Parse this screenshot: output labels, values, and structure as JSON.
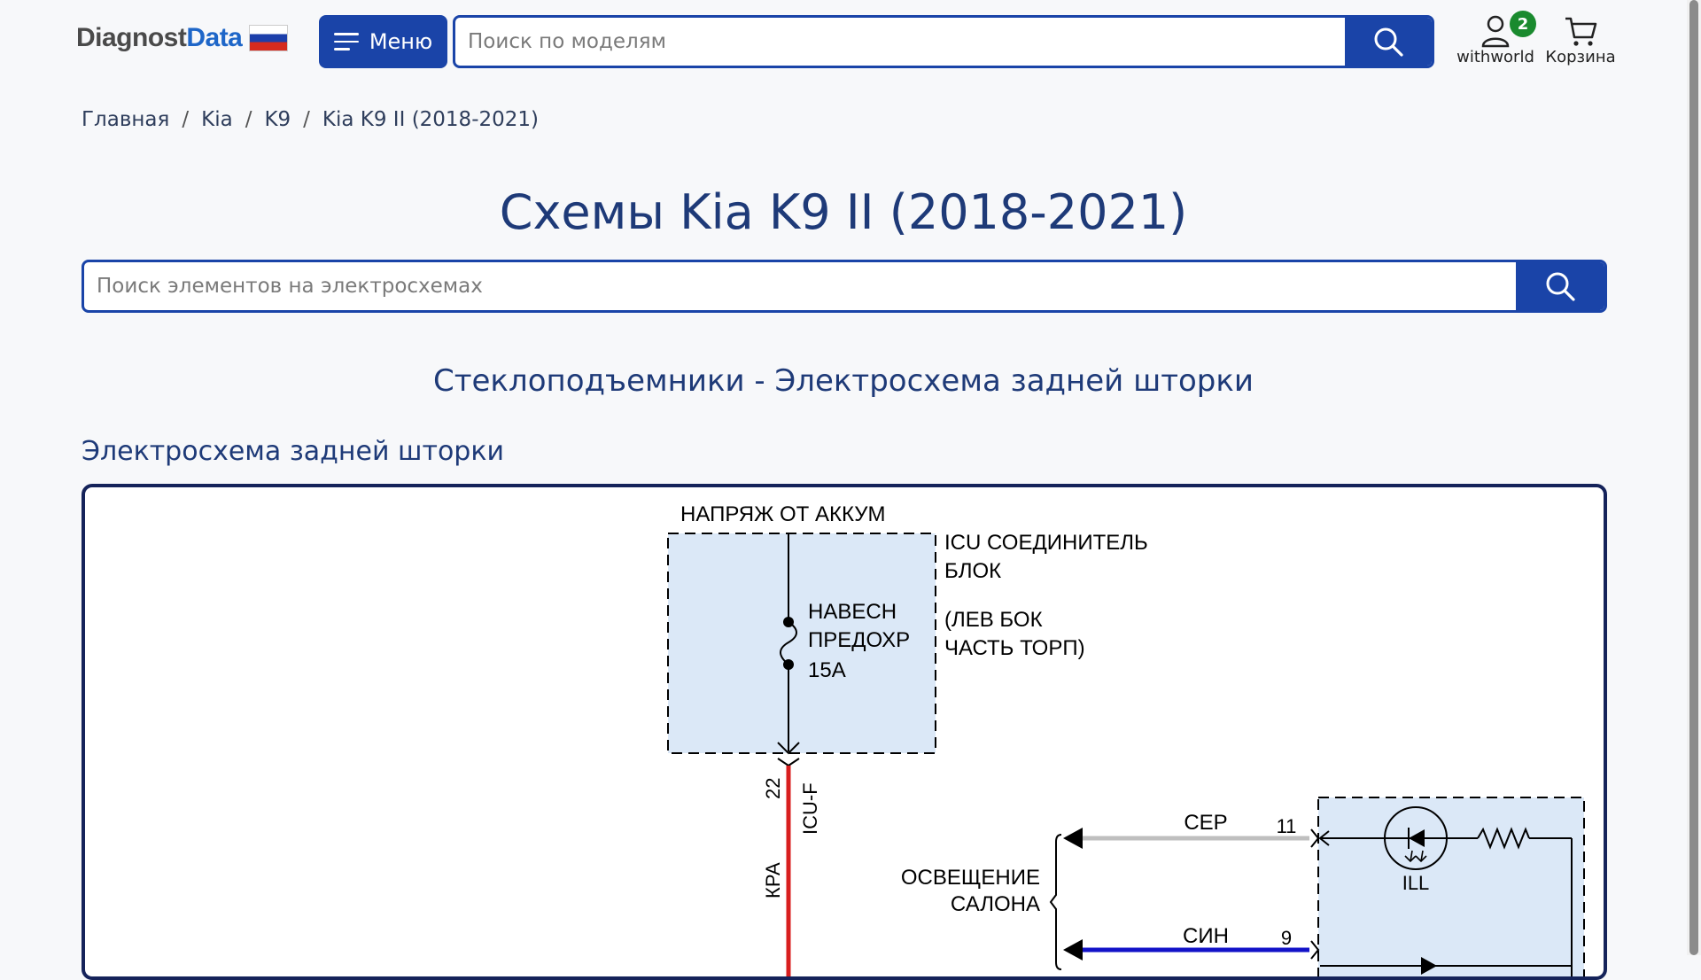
{
  "header": {
    "logo_part1": "Diagnost",
    "logo_part2": "Data",
    "menu_label": "Меню",
    "search_placeholder": "Поиск по моделям",
    "user_name": "withworld",
    "user_badge": "2",
    "cart_label": "Корзина"
  },
  "breadcrumb": {
    "items": [
      "Главная",
      "Kia",
      "K9",
      "Kia K9 II (2018-2021)"
    ],
    "separator": "/"
  },
  "page_title": "Схемы Kia K9 II (2018-2021)",
  "element_search_placeholder": "Поиск элементов на электросхемах",
  "section_title": "Стеклоподъемники - Электросхема задней шторки",
  "diagram_title": "Электросхема задней шторки",
  "diagram": {
    "battery_label": "НАПРЯЖ ОТ АККУМ",
    "icu_block_line1": "ICU СОЕДИНИТЕЛЬ",
    "icu_block_line2": "БЛОК",
    "icu_location_line1": "(ЛЕВ БОК",
    "icu_location_line2": "ЧАСТЬ ТОРП)",
    "fuse_line1": "НАВЕСН",
    "fuse_line2": "ПРЕДОХР",
    "fuse_line3": "15A",
    "pin_22": "22",
    "connector_icu_f": "ICU-F",
    "wire_red": "КРА",
    "wire_gray": "СЕР",
    "pin_11": "11",
    "wire_blue": "СИН",
    "pin_9": "9",
    "lighting_line1": "ОСВЕЩЕНИЕ",
    "lighting_line2": "САЛОНА",
    "ill_label": "ILL"
  },
  "colors": {
    "primary": "#1a44a8",
    "title": "#1e3a78",
    "badge": "#1a8a2e",
    "block_fill": "#dbe8f7",
    "wire_red": "#d81e1e",
    "wire_gray": "#bfbfbf",
    "wire_blue": "#1212c8"
  }
}
